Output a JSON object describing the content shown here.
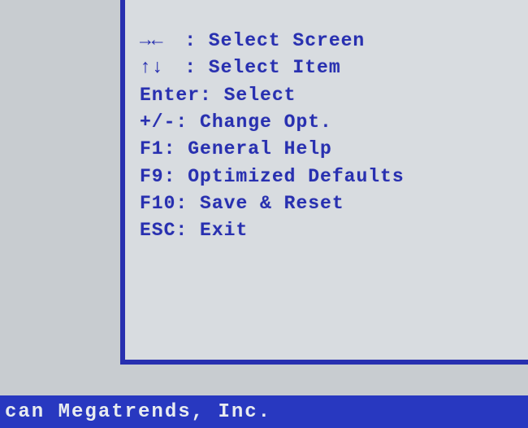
{
  "help": {
    "lines": [
      {
        "key": "→←",
        "label": "Select Screen"
      },
      {
        "key": "↑↓",
        "label": "Select Item"
      },
      {
        "key": "Enter",
        "label": "Select"
      },
      {
        "key": "+/-",
        "label": "Change Opt."
      },
      {
        "key": "F1",
        "label": "General Help"
      },
      {
        "key": "F9",
        "label": "Optimized Defaults"
      },
      {
        "key": "F10",
        "label": "Save & Reset"
      },
      {
        "key": "ESC",
        "label": "Exit"
      }
    ]
  },
  "footer": {
    "vendor_fragment": "can Megatrends, Inc."
  }
}
